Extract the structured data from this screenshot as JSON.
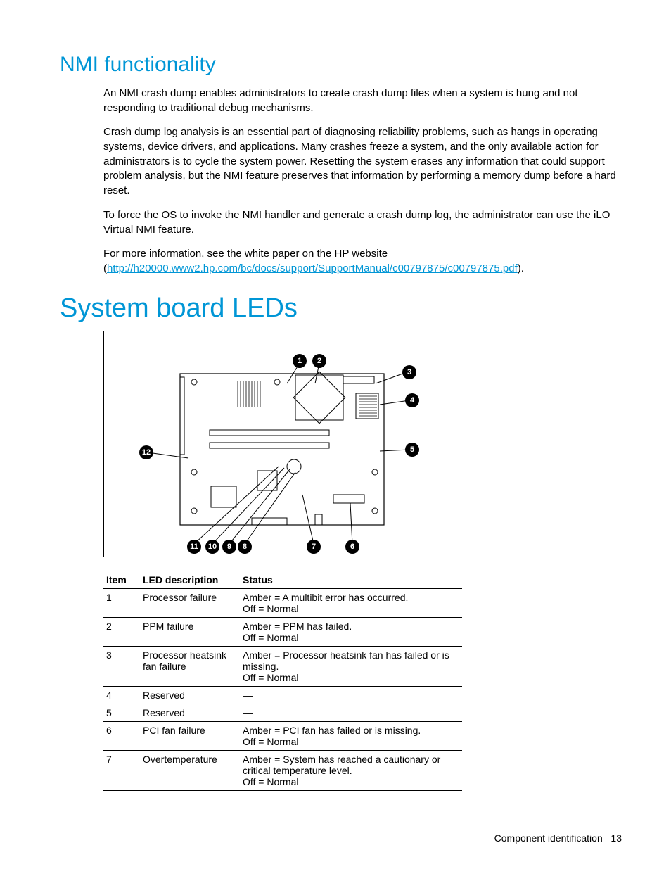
{
  "section1": {
    "heading": "NMI functionality",
    "p1": "An NMI crash dump enables administrators to create crash dump files when a system is hung and not responding to traditional debug mechanisms.",
    "p2": "Crash dump log analysis is an essential part of diagnosing reliability problems, such as hangs in operating systems, device drivers, and applications. Many crashes freeze a system, and the only available action for administrators is to cycle the system power. Resetting the system erases any information that could support problem analysis, but the NMI feature preserves that information by performing a memory dump before a hard reset.",
    "p3": "To force the OS to invoke the NMI handler and generate a crash dump log, the administrator can use the iLO Virtual NMI feature.",
    "p4a": "For more information, see the white paper on the HP website (",
    "p4link": "http://h20000.www2.hp.com/bc/docs/support/SupportManual/c00797875/c00797875.pdf",
    "p4b": ")."
  },
  "section2": {
    "heading": "System board LEDs",
    "callouts": [
      "1",
      "2",
      "3",
      "4",
      "5",
      "6",
      "7",
      "8",
      "9",
      "10",
      "11",
      "12"
    ],
    "table": {
      "headers": {
        "c1": "Item",
        "c2": "LED description",
        "c3": "Status"
      },
      "rows": [
        {
          "item": "1",
          "desc": "Processor failure",
          "status": "Amber = A multibit error has occurred.\nOff = Normal"
        },
        {
          "item": "2",
          "desc": "PPM failure",
          "status": "Amber = PPM has failed.\nOff = Normal"
        },
        {
          "item": "3",
          "desc": "Processor heatsink fan failure",
          "status": "Amber = Processor heatsink fan has failed or is missing.\nOff = Normal"
        },
        {
          "item": "4",
          "desc": "Reserved",
          "status": "—"
        },
        {
          "item": "5",
          "desc": "Reserved",
          "status": "—"
        },
        {
          "item": "6",
          "desc": "PCI fan failure",
          "status": "Amber = PCI fan has failed or is missing.\nOff = Normal"
        },
        {
          "item": "7",
          "desc": "Overtemperature",
          "status": "Amber = System has reached a cautionary or critical temperature level.\nOff = Normal"
        }
      ]
    }
  },
  "footer": {
    "section": "Component identification",
    "page": "13"
  }
}
